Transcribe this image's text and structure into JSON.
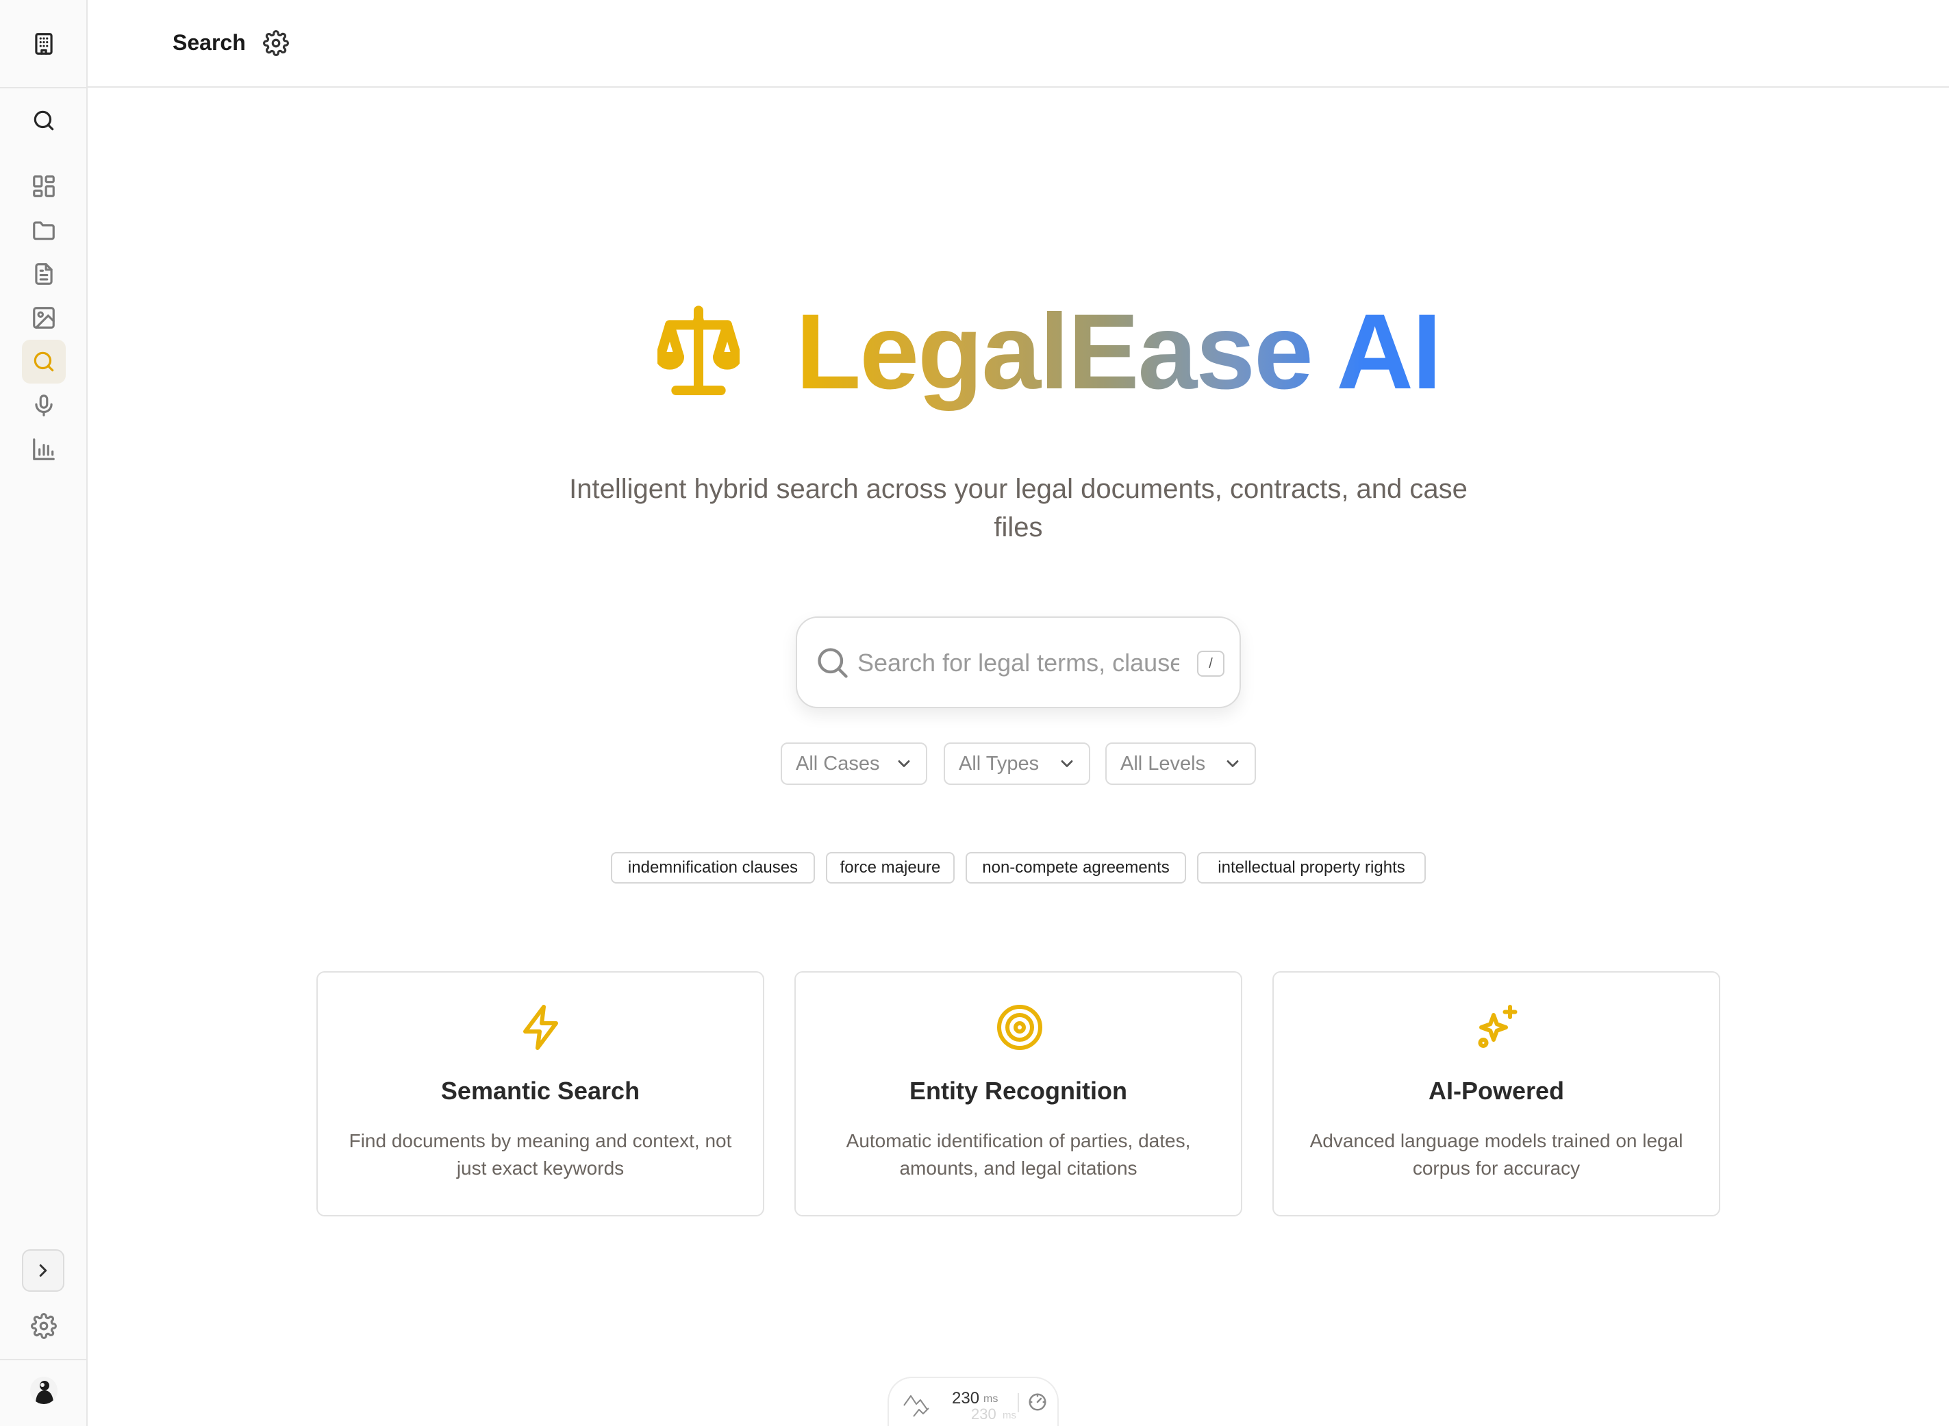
{
  "header": {
    "title": "Search"
  },
  "sidebar": {
    "items": [
      {
        "name": "building-icon",
        "active": false
      },
      {
        "name": "search-icon",
        "active": false
      },
      {
        "name": "dashboard-icon",
        "active": false
      },
      {
        "name": "folder-icon",
        "active": false
      },
      {
        "name": "document-icon",
        "active": false
      },
      {
        "name": "image-icon",
        "active": false
      },
      {
        "name": "search-icon",
        "active": true
      },
      {
        "name": "microphone-icon",
        "active": false
      },
      {
        "name": "bar-chart-icon",
        "active": false
      }
    ],
    "bottom": [
      "chevron-right-icon",
      "gear-icon",
      "avatar"
    ]
  },
  "hero": {
    "brand": "LegalEase AI",
    "logo_icon": "scales-icon",
    "tagline": "Intelligent hybrid search across your legal documents, contracts, and case files"
  },
  "search": {
    "placeholder": "Search for legal terms, clauses, or concepts...",
    "shortcut": "/"
  },
  "filters": [
    {
      "label": "All Cases"
    },
    {
      "label": "All Types"
    },
    {
      "label": "All Levels"
    }
  ],
  "suggestions": [
    "indemnification clauses",
    "force majeure",
    "non-compete agreements",
    "intellectual property rights"
  ],
  "features": [
    {
      "icon": "lightning-icon",
      "title": "Semantic Search",
      "description": "Find documents by meaning and context, not just exact keywords"
    },
    {
      "icon": "target-icon",
      "title": "Entity Recognition",
      "description": "Automatic identification of parties, dates, amounts, and legal citations"
    },
    {
      "icon": "sparkles-icon",
      "title": "AI-Powered",
      "description": "Advanced language models trained on legal corpus for accuracy"
    }
  ],
  "latency": {
    "value": "230",
    "unit": "ms"
  },
  "colors": {
    "accent": "#eab308",
    "brand_blue": "#3b82f6",
    "muted_text": "#6b6560",
    "border": "#e2e2e2"
  }
}
